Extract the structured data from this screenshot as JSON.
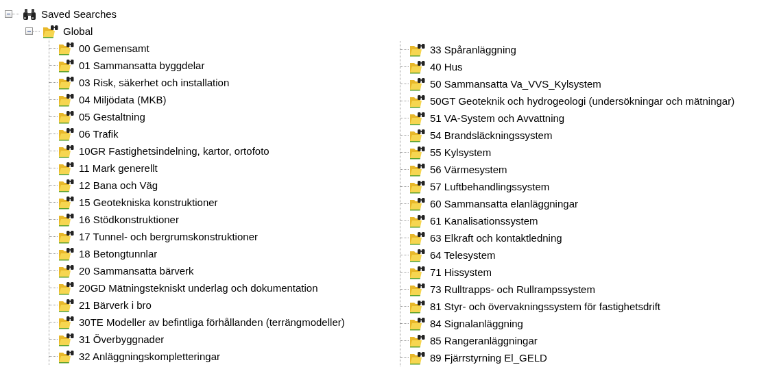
{
  "tree": {
    "label": "Saved Searches",
    "expanded": true,
    "children": [
      {
        "label": "Global",
        "expanded": true,
        "children": [
          {
            "label": "00 Gemensamt"
          },
          {
            "label": "01 Sammansatta byggdelar"
          },
          {
            "label": "03 Risk, säkerhet och installation"
          },
          {
            "label": "04 Miljödata (MKB)"
          },
          {
            "label": "05 Gestaltning"
          },
          {
            "label": "06 Trafik"
          },
          {
            "label": "10GR Fastighetsindelning, kartor, ortofoto"
          },
          {
            "label": "11 Mark generellt"
          },
          {
            "label": "12 Bana och Väg"
          },
          {
            "label": "15 Geotekniska konstruktioner"
          },
          {
            "label": "16 Stödkonstruktioner"
          },
          {
            "label": "17 Tunnel- och bergrumskonstruktioner"
          },
          {
            "label": "18 Betongtunnlar"
          },
          {
            "label": "20 Sammansatta bärverk"
          },
          {
            "label": "20GD Mätningstekniskt underlag och dokumentation"
          },
          {
            "label": "21 Bärverk i bro"
          },
          {
            "label": "30TE Modeller av befintliga förhållanden (terrängmodeller)"
          },
          {
            "label": "31 Överbyggnader"
          },
          {
            "label": "32 Anläggningskompletteringar"
          },
          {
            "label": "33 Spåranläggning"
          },
          {
            "label": "40 Hus"
          },
          {
            "label": "50 Sammansatta Va_VVS_Kylsystem"
          },
          {
            "label": "50GT Geoteknik och hydrogeologi (undersökningar och mätningar)"
          },
          {
            "label": "51 VA-System och Avvattning"
          },
          {
            "label": "54 Brandsläckningssystem"
          },
          {
            "label": "55 Kylsystem"
          },
          {
            "label": "56 Värmesystem"
          },
          {
            "label": "57 Luftbehandlingssystem"
          },
          {
            "label": "60 Sammansatta elanläggningar"
          },
          {
            "label": "61 Kanalisationssystem"
          },
          {
            "label": "63 Elkraft och kontaktledning"
          },
          {
            "label": "64 Telesystem"
          },
          {
            "label": "71 Hissystem"
          },
          {
            "label": "73 Rulltrapps- och Rullrampssystem"
          },
          {
            "label": "81 Styr- och övervakningssystem för fastighetsdrift"
          },
          {
            "label": "84 Signalanläggning"
          },
          {
            "label": "85 Rangeranläggningar"
          },
          {
            "label": "89 Fjärrstyrning El_GELD"
          }
        ]
      }
    ]
  }
}
